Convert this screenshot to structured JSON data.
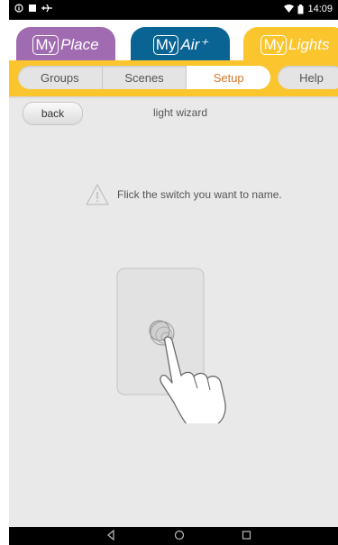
{
  "status_bar": {
    "time": "14:09",
    "left_icons": [
      "info-icon",
      "image-icon",
      "airplane-icon"
    ],
    "right_icons": [
      "wifi-icon",
      "battery-icon"
    ]
  },
  "app_tabs": [
    {
      "my": "My",
      "name": "Place",
      "color": "#a06bb0"
    },
    {
      "my": "My",
      "name": "Air⁺",
      "color": "#0a6493"
    },
    {
      "my": "My",
      "name": "Lights",
      "color": "#fbc52d",
      "active": true
    }
  ],
  "sub_tabs": {
    "items": [
      "Groups",
      "Scenes",
      "Setup"
    ],
    "active": "Setup",
    "help_label": "Help"
  },
  "content": {
    "back_label": "back",
    "title": "light wizard",
    "instruction": "Flick the switch you want to name.",
    "illustration": "hand-pressing-switch-icon"
  },
  "nav_bar": {
    "icons": [
      "back-nav-icon",
      "home-nav-icon",
      "recents-nav-icon"
    ]
  },
  "colors": {
    "accent_yellow": "#fbc52d",
    "active_tab_text": "#d77a2a",
    "purple": "#a06bb0",
    "blue": "#0a6493",
    "background": "#e9e9e9"
  }
}
